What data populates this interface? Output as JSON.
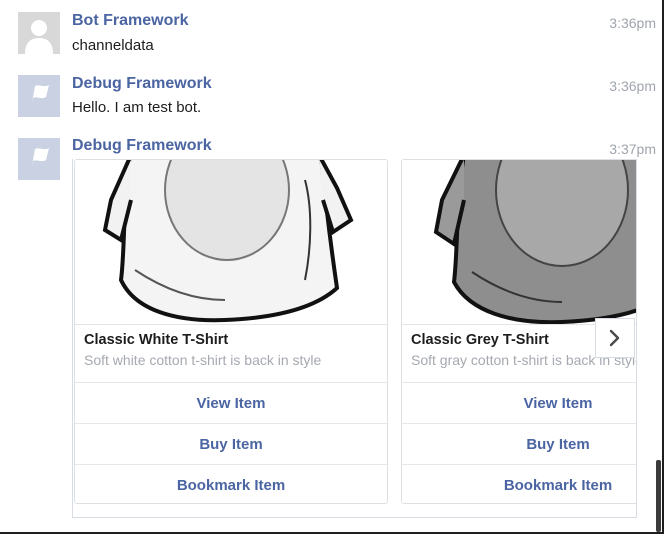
{
  "messages": [
    {
      "sender": "Bot Framework",
      "text": "channeldata",
      "time": "3:36pm",
      "avatar_icon": "person-silhouette-icon"
    },
    {
      "sender": "Debug Framework",
      "text": "Hello. I am test bot.",
      "time": "3:36pm",
      "avatar_icon": "flag-icon"
    },
    {
      "sender": "Debug Framework",
      "time": "3:37pm",
      "avatar_icon": "flag-icon"
    }
  ],
  "carousel": {
    "cards": [
      {
        "title": "Classic White T-Shirt",
        "subtitle": "Soft white cotton t-shirt is back in style",
        "image": "white-tshirt-image",
        "buttons": [
          "View Item",
          "Buy Item",
          "Bookmark Item"
        ]
      },
      {
        "title": "Classic Grey T-Shirt",
        "subtitle": "Soft gray cotton t-shirt is back in style",
        "image": "grey-tshirt-image",
        "buttons": [
          "View Item",
          "Buy Item",
          "Bookmark Item"
        ]
      }
    ],
    "next_icon": "chevron-right-icon"
  },
  "colors": {
    "sender": "#4b65a3",
    "button_text": "#4b65a3",
    "timestamp": "#a0a5ad",
    "avatar_bot": "#c9d1e2",
    "avatar_person": "#d8d8d8"
  }
}
